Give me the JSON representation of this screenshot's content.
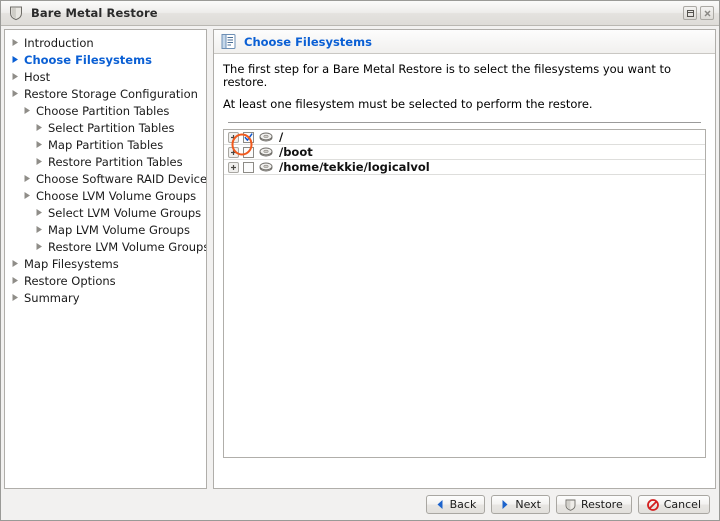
{
  "window": {
    "title": "Bare Metal Restore",
    "title_icon": "shield-icon",
    "buttons": {
      "maximize": "maximize-icon",
      "close": "close-icon"
    }
  },
  "sidebar": {
    "items": [
      {
        "label": "Introduction",
        "level": 0,
        "selected": false
      },
      {
        "label": "Choose Filesystems",
        "level": 0,
        "selected": true
      },
      {
        "label": "Host",
        "level": 0,
        "selected": false
      },
      {
        "label": "Restore Storage Configuration",
        "level": 0,
        "selected": false
      },
      {
        "label": "Choose Partition Tables",
        "level": 1,
        "selected": false
      },
      {
        "label": "Select Partition Tables",
        "level": 2,
        "selected": false
      },
      {
        "label": "Map Partition Tables",
        "level": 2,
        "selected": false
      },
      {
        "label": "Restore Partition Tables",
        "level": 2,
        "selected": false
      },
      {
        "label": "Choose Software RAID Devices",
        "level": 1,
        "selected": false
      },
      {
        "label": "Choose LVM Volume Groups",
        "level": 1,
        "selected": false
      },
      {
        "label": "Select LVM Volume Groups",
        "level": 2,
        "selected": false
      },
      {
        "label": "Map LVM Volume Groups",
        "level": 2,
        "selected": false
      },
      {
        "label": "Restore LVM Volume Groups",
        "level": 2,
        "selected": false
      },
      {
        "label": "Map Filesystems",
        "level": 0,
        "selected": false
      },
      {
        "label": "Restore Options",
        "level": 0,
        "selected": false
      },
      {
        "label": "Summary",
        "level": 0,
        "selected": false
      }
    ]
  },
  "main": {
    "header": {
      "icon": "document-list-icon",
      "title": "Choose Filesystems"
    },
    "description": [
      "The first step for a Bare Metal Restore is to select the filesystems you want to restore.",
      "At least one filesystem must be selected to perform the restore."
    ],
    "filesystems": [
      {
        "label": "/",
        "checked": true,
        "expandable": true,
        "annotated": true
      },
      {
        "label": "/boot",
        "checked": false,
        "expandable": true,
        "annotated": false
      },
      {
        "label": "/home/tekkie/logicalvol",
        "checked": false,
        "expandable": true,
        "annotated": false
      }
    ]
  },
  "footer": {
    "buttons": [
      {
        "label": "Back",
        "icon": "chevron-left-icon"
      },
      {
        "label": "Next",
        "icon": "chevron-right-icon"
      },
      {
        "label": "Restore",
        "icon": "shield-icon"
      },
      {
        "label": "Cancel",
        "icon": "cancel-icon"
      }
    ]
  },
  "colors": {
    "accent_blue": "#0a5fd4",
    "annotation_orange": "#f05a1e",
    "cancel_red": "#d42020",
    "window_bg": "#f2f1f0"
  }
}
